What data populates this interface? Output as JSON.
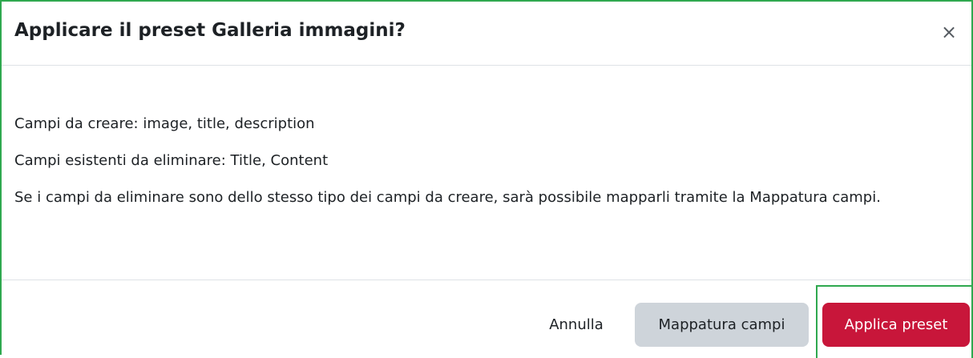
{
  "dialog": {
    "title": "Applicare il preset Galleria immagini?",
    "close_symbol": "×",
    "close_icon": "close-icon"
  },
  "body": {
    "fields_to_create": "Campi da creare: image, title, description",
    "fields_to_delete": "Campi esistenti da eliminare: Title, Content",
    "mapping_note": "Se i campi da eliminare sono dello stesso tipo dei campi da creare, sarà possibile mapparli tramite la Mappatura campi."
  },
  "footer": {
    "cancel_label": "Annulla",
    "mapping_label": "Mappatura campi",
    "apply_label": "Applica preset"
  },
  "colors": {
    "primary_button": "#c8163a",
    "secondary_button": "#ced4da",
    "focus_outline": "#2fa84f"
  }
}
